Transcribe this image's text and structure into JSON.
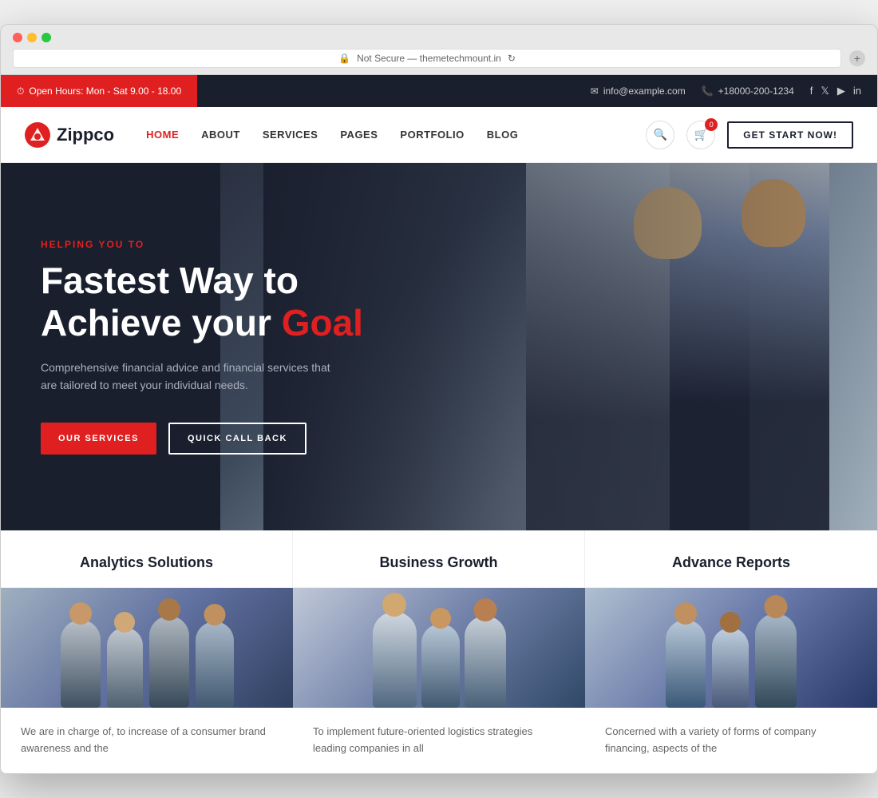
{
  "browser": {
    "url": "Not Secure — themetechmount.in",
    "add_tab": "+"
  },
  "topbar": {
    "hours": "Open Hours: Mon - Sat 9.00 - 18.00",
    "email": "info@example.com",
    "phone": "+18000-200-1234",
    "social": [
      "f",
      "t",
      "in",
      "li"
    ]
  },
  "navbar": {
    "logo_text": "Zippco",
    "logo_symbol": "Z",
    "nav_items": [
      {
        "label": "HOME",
        "active": true
      },
      {
        "label": "ABOUT"
      },
      {
        "label": "SERVICES"
      },
      {
        "label": "PAGES"
      },
      {
        "label": "PORTFOLIO"
      },
      {
        "label": "BLOG"
      }
    ],
    "cart_badge": "0",
    "cta_label": "GET START NOW!"
  },
  "hero": {
    "eyebrow": "HELPING YOU TO",
    "title_line1": "Fastest Way to",
    "title_line2": "Achieve your",
    "title_highlight": "Goal",
    "subtitle": "Comprehensive financial advice and financial services that are tailored to meet your individual needs.",
    "btn1_label": "OUR SERVICES",
    "btn2_label": "QUICK CALL BACK"
  },
  "services": [
    {
      "title": "Analytics Solutions",
      "description": "We are in charge of, to increase of a consumer brand awareness and the"
    },
    {
      "title": "Business Growth",
      "description": "To implement future-oriented logistics strategies leading companies in all"
    },
    {
      "title": "Advance Reports",
      "description": "Concerned with a variety of forms of company financing, aspects of the"
    }
  ],
  "colors": {
    "red": "#e02020",
    "dark": "#1a1f2e",
    "white": "#ffffff"
  }
}
